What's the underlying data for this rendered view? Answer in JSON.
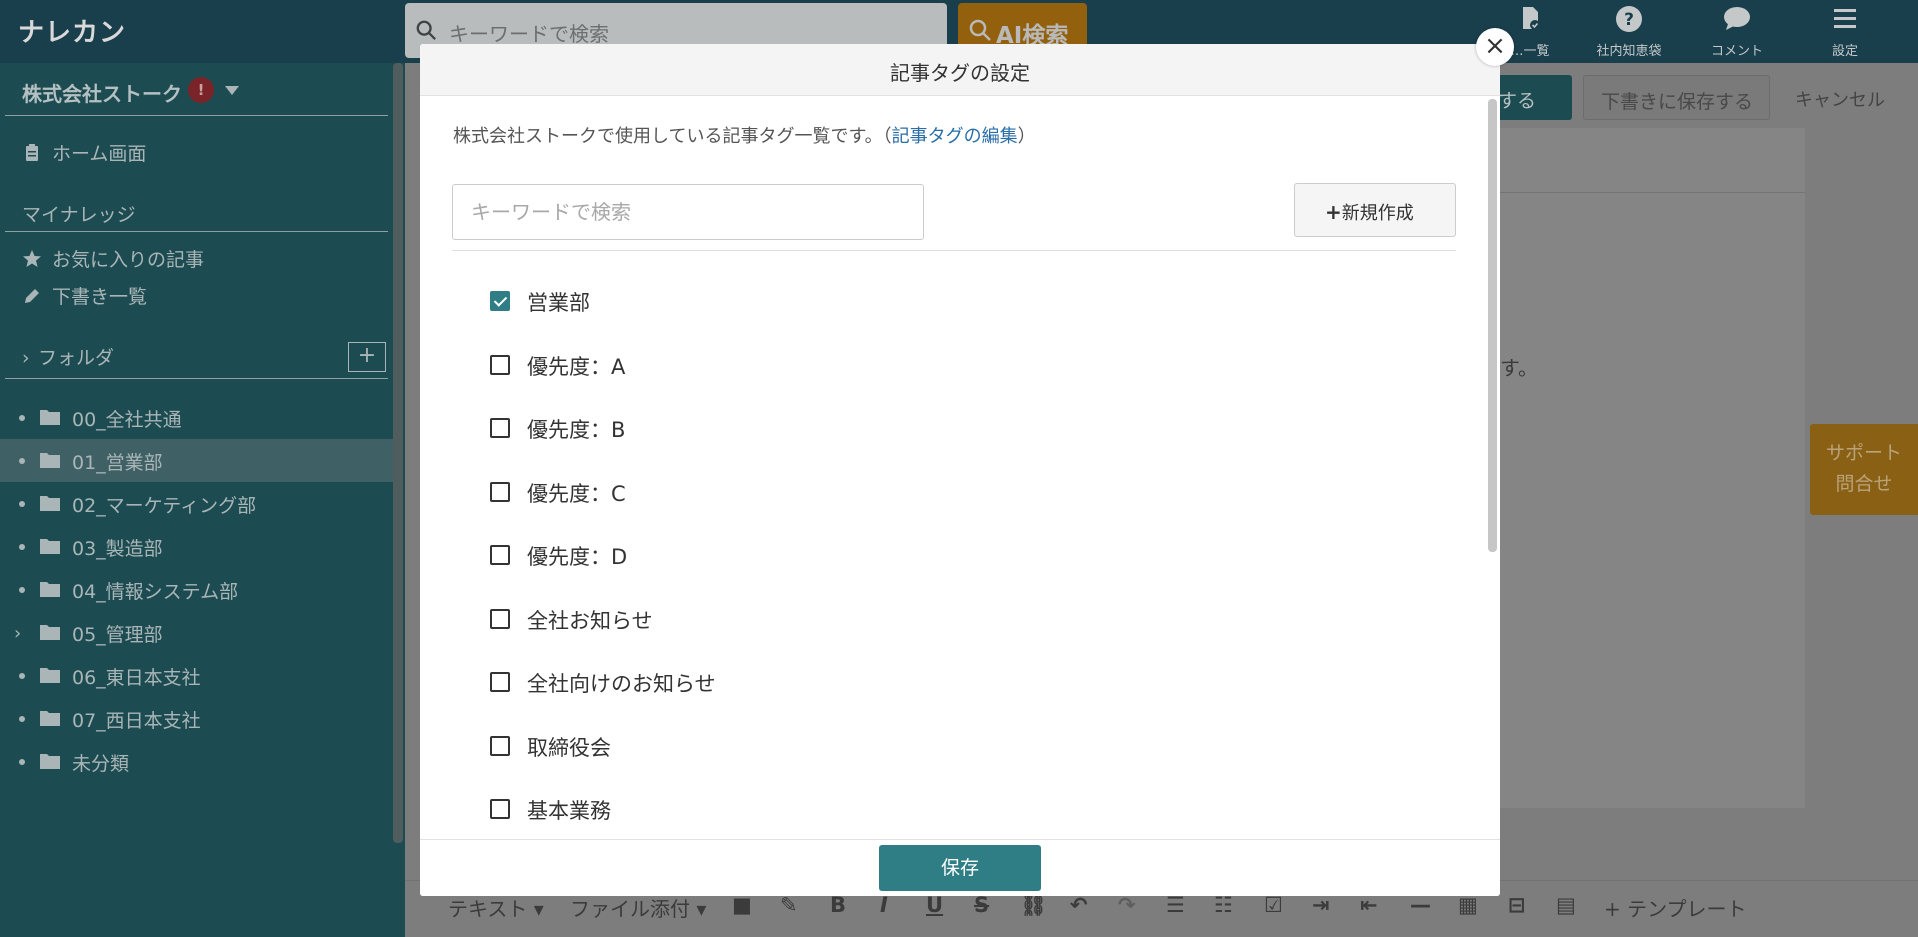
{
  "header": {
    "brand": "ナレカン",
    "search_placeholder": "キーワードで検索",
    "ai_search": "AI検索",
    "nav": [
      {
        "label": "…一覧",
        "icon": "document-check-icon"
      },
      {
        "label": "社内知恵袋",
        "icon": "question-circle-icon"
      },
      {
        "label": "コメント",
        "icon": "comment-icon"
      },
      {
        "label": "設定",
        "icon": "hamburger-menu-icon"
      }
    ]
  },
  "sidebar": {
    "company": "株式会社ストーク",
    "alert_badge": "!",
    "home": "ホーム画面",
    "my_knowledge_heading": "マイナレッジ",
    "favorites": "お気に入りの記事",
    "drafts": "下書き一覧",
    "folder_heading": "フォルダ",
    "folders": [
      {
        "label": "00_全社共通",
        "expandable": false,
        "active": false
      },
      {
        "label": "01_営業部",
        "expandable": false,
        "active": true
      },
      {
        "label": "02_マーケティング部",
        "expandable": false,
        "active": false
      },
      {
        "label": "03_製造部",
        "expandable": false,
        "active": false
      },
      {
        "label": "04_情報システム部",
        "expandable": false,
        "active": false
      },
      {
        "label": "05_管理部",
        "expandable": true,
        "active": false
      },
      {
        "label": "06_東日本支社",
        "expandable": false,
        "active": false
      },
      {
        "label": "07_西日本支社",
        "expandable": false,
        "active": false
      },
      {
        "label": "未分類",
        "expandable": false,
        "active": false
      }
    ]
  },
  "background": {
    "publish_partial": "する",
    "save_draft": "下書きに保存する",
    "cancel": "キャンセル",
    "body_partial": "す。",
    "support_line1": "サポート",
    "support_line2": "問合せ",
    "toolbar": {
      "text": "テキスト",
      "attach": "ファイル添付",
      "template": "テンプレート"
    }
  },
  "modal": {
    "title": "記事タグの設定",
    "intro_text": "株式会社ストークで使用している記事タグ一覧です。（",
    "intro_link": "記事タグの編集",
    "intro_close": "）",
    "search_placeholder": "キーワードで検索",
    "new_button": "新規作成",
    "tags": [
      {
        "label": "営業部",
        "checked": true
      },
      {
        "label": "優先度：A",
        "checked": false
      },
      {
        "label": "優先度：B",
        "checked": false
      },
      {
        "label": "優先度：C",
        "checked": false
      },
      {
        "label": "優先度：D",
        "checked": false
      },
      {
        "label": "全社お知らせ",
        "checked": false
      },
      {
        "label": "全社向けのお知らせ",
        "checked": false
      },
      {
        "label": "取締役会",
        "checked": false
      },
      {
        "label": "基本業務",
        "checked": false
      }
    ],
    "save": "保存",
    "accent_color": "#2f7e86"
  }
}
